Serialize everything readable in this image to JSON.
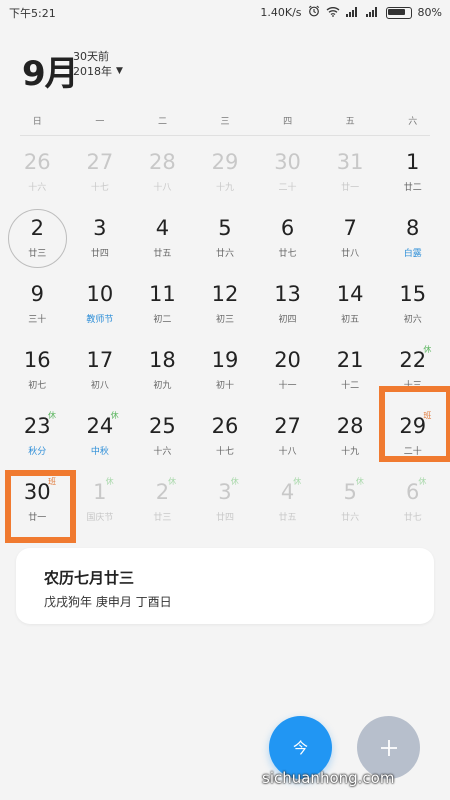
{
  "status_bar": {
    "time": "下午5:21",
    "network_speed": "1.40K/s",
    "battery": "80%"
  },
  "header": {
    "month": "9月",
    "relative": "30天前",
    "year": "2018年"
  },
  "weekdays": [
    "日",
    "一",
    "二",
    "三",
    "四",
    "五",
    "六"
  ],
  "days": [
    {
      "num": "26",
      "lunar": "十六",
      "other": true
    },
    {
      "num": "27",
      "lunar": "十七",
      "other": true
    },
    {
      "num": "28",
      "lunar": "十八",
      "other": true
    },
    {
      "num": "29",
      "lunar": "十九",
      "other": true
    },
    {
      "num": "30",
      "lunar": "二十",
      "other": true
    },
    {
      "num": "31",
      "lunar": "廿一",
      "other": true
    },
    {
      "num": "1",
      "lunar": "廿二"
    },
    {
      "num": "2",
      "lunar": "廿三",
      "selected": true
    },
    {
      "num": "3",
      "lunar": "廿四"
    },
    {
      "num": "4",
      "lunar": "廿五"
    },
    {
      "num": "5",
      "lunar": "廿六"
    },
    {
      "num": "6",
      "lunar": "廿七"
    },
    {
      "num": "7",
      "lunar": "廿八"
    },
    {
      "num": "8",
      "lunar": "白露",
      "festival": true
    },
    {
      "num": "9",
      "lunar": "三十"
    },
    {
      "num": "10",
      "lunar": "教师节",
      "festival": true
    },
    {
      "num": "11",
      "lunar": "初二"
    },
    {
      "num": "12",
      "lunar": "初三"
    },
    {
      "num": "13",
      "lunar": "初四"
    },
    {
      "num": "14",
      "lunar": "初五"
    },
    {
      "num": "15",
      "lunar": "初六"
    },
    {
      "num": "16",
      "lunar": "初七"
    },
    {
      "num": "17",
      "lunar": "初八"
    },
    {
      "num": "18",
      "lunar": "初九"
    },
    {
      "num": "19",
      "lunar": "初十"
    },
    {
      "num": "20",
      "lunar": "十一"
    },
    {
      "num": "21",
      "lunar": "十二"
    },
    {
      "num": "22",
      "lunar": "十三",
      "badge": "休",
      "badge_type": "rest"
    },
    {
      "num": "23",
      "lunar": "秋分",
      "festival": true,
      "badge": "休",
      "badge_type": "rest"
    },
    {
      "num": "24",
      "lunar": "中秋",
      "festival": true,
      "badge": "休",
      "badge_type": "rest"
    },
    {
      "num": "25",
      "lunar": "十六"
    },
    {
      "num": "26",
      "lunar": "十七"
    },
    {
      "num": "27",
      "lunar": "十八"
    },
    {
      "num": "28",
      "lunar": "十九"
    },
    {
      "num": "29",
      "lunar": "二十",
      "badge": "班",
      "badge_type": "work",
      "highlight": true
    },
    {
      "num": "30",
      "lunar": "廿一",
      "badge": "班",
      "badge_type": "work",
      "highlight": true
    },
    {
      "num": "1",
      "lunar": "国庆节",
      "other": true,
      "festival": true,
      "badge": "休",
      "badge_type": "rest"
    },
    {
      "num": "2",
      "lunar": "廿三",
      "other": true,
      "badge": "休",
      "badge_type": "rest"
    },
    {
      "num": "3",
      "lunar": "廿四",
      "other": true,
      "badge": "休",
      "badge_type": "rest"
    },
    {
      "num": "4",
      "lunar": "廿五",
      "other": true,
      "badge": "休",
      "badge_type": "rest"
    },
    {
      "num": "5",
      "lunar": "廿六",
      "other": true,
      "badge": "休",
      "badge_type": "rest"
    },
    {
      "num": "6",
      "lunar": "廿七",
      "other": true,
      "badge": "休",
      "badge_type": "rest"
    }
  ],
  "detail_card": {
    "lunar_date": "农历七月廿三",
    "ganzhi": "戊戌狗年 庚申月 丁酉日"
  },
  "buttons": {
    "today_label": "今"
  },
  "watermark": "sichuanhong.com",
  "colors": {
    "accent": "#2196f3",
    "highlight_frame": "#f07a30",
    "rest_badge": "#5bb55f",
    "work_badge": "#e07a3b",
    "festival_text": "#2f8fd8"
  }
}
